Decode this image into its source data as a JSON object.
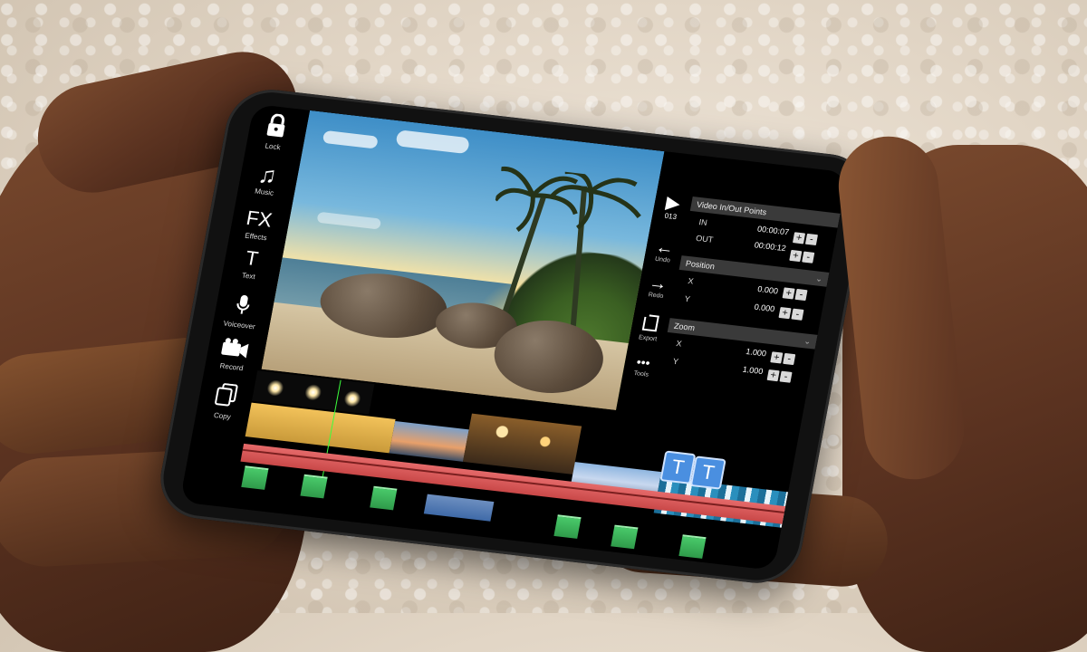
{
  "toolbar": {
    "items": [
      {
        "label": "Lock",
        "icon": "lock-icon"
      },
      {
        "label": "Music",
        "icon": "music-note-icon"
      },
      {
        "label": "Effects",
        "icon": "fx-icon",
        "glyph": "FX"
      },
      {
        "label": "Text",
        "icon": "text-icon",
        "glyph": "T"
      },
      {
        "label": "Voiceover",
        "icon": "microphone-icon"
      },
      {
        "label": "Record",
        "icon": "camera-icon"
      },
      {
        "label": "Copy",
        "icon": "copy-icon"
      }
    ]
  },
  "side_actions": {
    "frame_label": "013",
    "items": [
      {
        "label": "Undo",
        "icon": "undo-arrow-icon"
      },
      {
        "label": "Redo",
        "icon": "redo-arrow-icon"
      },
      {
        "label": "Export",
        "icon": "export-icon"
      },
      {
        "label": "Tools",
        "icon": "more-dots-icon"
      }
    ]
  },
  "properties": {
    "video_points": {
      "title": "Video In/Out Points",
      "in_label": "IN",
      "in_value": "00:00:07",
      "out_label": "OUT",
      "out_value": "00:00:12"
    },
    "position": {
      "title": "Position",
      "x_label": "X",
      "x_value": "0.000",
      "y_label": "Y",
      "y_value": "0.000"
    },
    "zoom": {
      "title": "Zoom",
      "x_label": "X",
      "x_value": "1.000",
      "y_label": "Y",
      "y_value": "1.000"
    },
    "plus": "+",
    "minus": "-"
  },
  "timeline": {
    "text_clip_glyph": "T"
  },
  "colors": {
    "accent_blue": "#4a8fe0",
    "audio_track": "#d55555",
    "green_clip": "#3cb25a",
    "playhead": "#3cff3c"
  }
}
